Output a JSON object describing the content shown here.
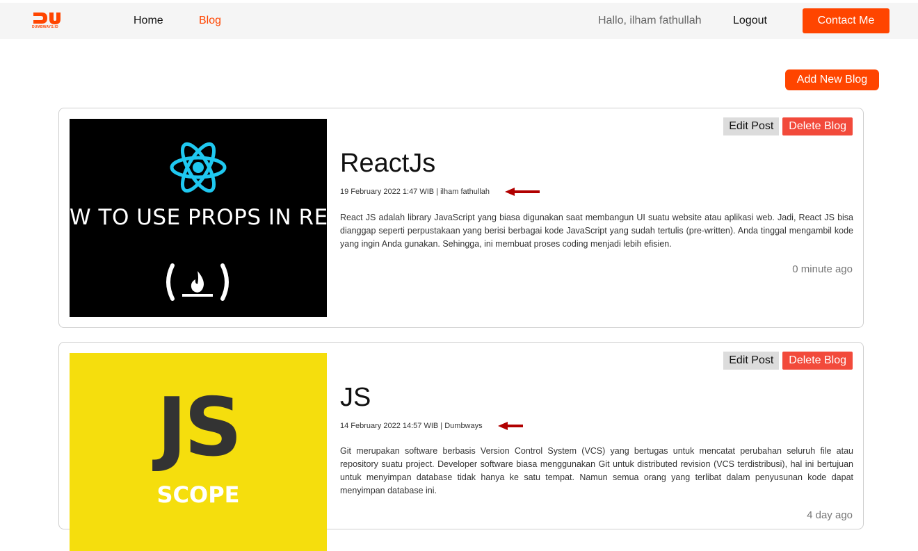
{
  "nav": {
    "logo_text": "DUMBWAYS.ID",
    "home_label": "Home",
    "blog_label": "Blog",
    "greeting": "Hallo, ilham fathullah",
    "logout_label": "Logout",
    "contact_label": "Contact Me"
  },
  "add_blog_label": "Add New Blog",
  "colors": {
    "accent": "#ff4500",
    "delete": "#f24a3b",
    "arrow": "#b10000"
  },
  "posts": [
    {
      "title": "ReactJs",
      "meta": "19 February 2022 1:47 WIB | ilham fathullah",
      "excerpt": "React JS adalah library JavaScript yang biasa digunakan saat membangun UI suatu website atau aplikasi web. Jadi, React JS bisa dianggap seperti perpustakaan yang berisi berbagai kode JavaScript yang sudah tertulis (pre-written). Anda tinggal mengambil kode yang ingin Anda gunakan. Sehingga, ini membuat proses coding menjadi lebih efisien.",
      "time_ago": "0 minute ago",
      "edit_label": "Edit Post",
      "delete_label": "Delete Blog",
      "thumb_text": "W TO USE PROPS IN REA"
    },
    {
      "title": "JS",
      "meta": "14 February 2022 14:57 WIB | Dumbways",
      "excerpt": "Git merupakan software berbasis Version Control System (VCS) yang bertugas untuk mencatat perubahan seluruh file atau repository suatu project. Developer software biasa menggunakan Git untuk distributed revision (VCS terdistribusi), hal ini bertujuan untuk menyimpan database tidak hanya ke satu tempat. Namun semua orang yang terlibat dalam penyusunan kode dapat menyimpan database ini.",
      "time_ago": "4 day ago",
      "edit_label": "Edit Post",
      "delete_label": "Delete Blog",
      "thumb_big": "JS",
      "thumb_sub": "SCOPE"
    }
  ]
}
